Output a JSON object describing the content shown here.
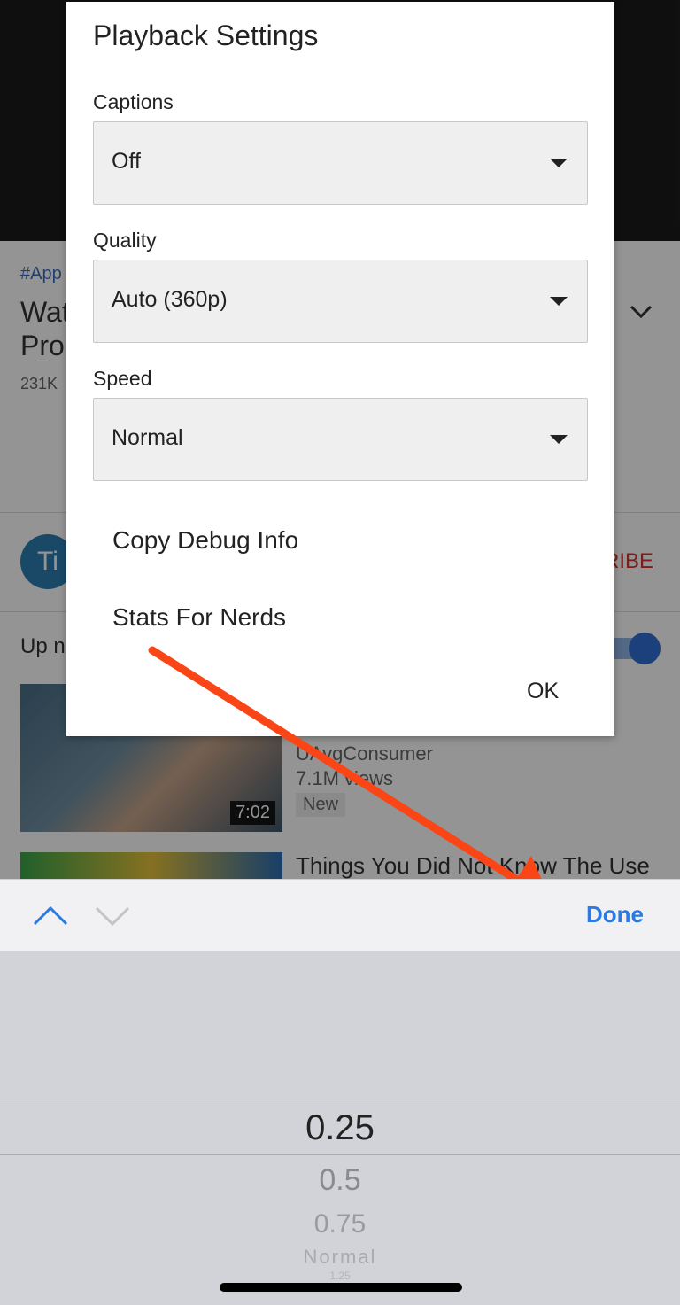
{
  "background_page": {
    "hashtag": "#App",
    "title_line1": "Wat",
    "title_line2": "Pro",
    "views": "231K",
    "channel_initials": "Ti",
    "subscribe_label": "RIBE",
    "up_next_label": "Up n",
    "videos": [
      {
        "duration": "7:02",
        "channel": "UAvgConsumer",
        "views": "7.1M views",
        "badge": "New"
      },
      {
        "title": "Things You Did Not Know The Use"
      }
    ]
  },
  "dialog": {
    "title": "Playback Settings",
    "captions": {
      "label": "Captions",
      "value": "Off"
    },
    "quality": {
      "label": "Quality",
      "value": "Auto (360p)"
    },
    "speed": {
      "label": "Speed",
      "value": "Normal"
    },
    "menu_items": [
      "Copy Debug Info",
      "Stats For Nerds"
    ],
    "ok_label": "OK"
  },
  "annotation": {
    "arrow_color": "#fa4616"
  },
  "keyboard_toolbar": {
    "prev_icon": "chevron-up-icon",
    "next_icon": "chevron-down-icon",
    "done_label": "Done",
    "accent_color": "#2a7ae2"
  },
  "picker": {
    "options": [
      "0.25",
      "0.5",
      "0.75",
      "Normal",
      "1.25"
    ],
    "selected": "0.25"
  }
}
